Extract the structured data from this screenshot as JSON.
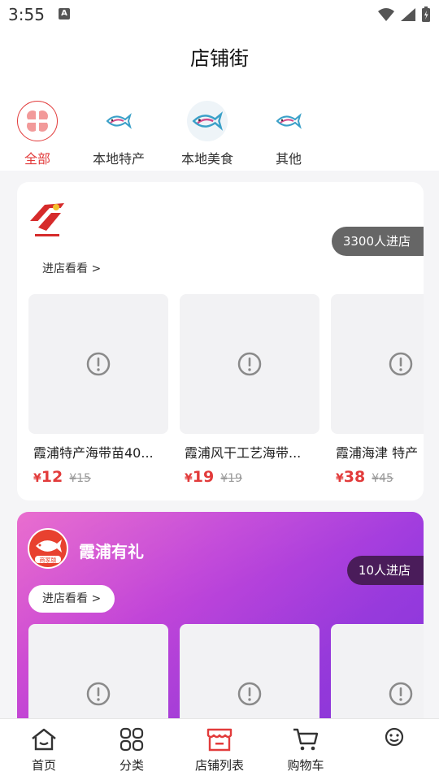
{
  "status": {
    "time": "3:55"
  },
  "header": {
    "title": "店铺街"
  },
  "categories": [
    {
      "label": "全部",
      "active": true
    },
    {
      "label": "本地特产",
      "active": false
    },
    {
      "label": "本地美食",
      "active": false
    },
    {
      "label": "其他",
      "active": false
    }
  ],
  "stores": [
    {
      "name": "",
      "visitors": "3300人进店",
      "enter_label": "进店看看 >",
      "products": [
        {
          "name": "霞浦特产海带苗40...",
          "currency": "¥",
          "price": "12",
          "old_price": "¥15"
        },
        {
          "name": "霞浦风干工艺海带...",
          "currency": "¥",
          "price": "19",
          "old_price": "¥19"
        },
        {
          "name": "霞浦海津 特产",
          "currency": "¥",
          "price": "38",
          "old_price": "¥45"
        }
      ]
    },
    {
      "name": "霞浦有礼",
      "logo_badge": "商家版",
      "visitors": "10人进店",
      "enter_label": "进店看看 >",
      "products": [
        {},
        {},
        {}
      ]
    }
  ],
  "tabbar": [
    {
      "label": "首页",
      "icon": "home-icon"
    },
    {
      "label": "分类",
      "icon": "grid-icon"
    },
    {
      "label": "店铺列表",
      "icon": "store-icon",
      "active": true
    },
    {
      "label": "购物车",
      "icon": "cart-icon"
    },
    {
      "label": "",
      "icon": "profile-icon"
    }
  ],
  "colors": {
    "accent": "#e23b3b",
    "store2_gradient_start": "#e65ac8",
    "store2_gradient_end": "#8a36e6",
    "badge_dark": "#666666"
  }
}
